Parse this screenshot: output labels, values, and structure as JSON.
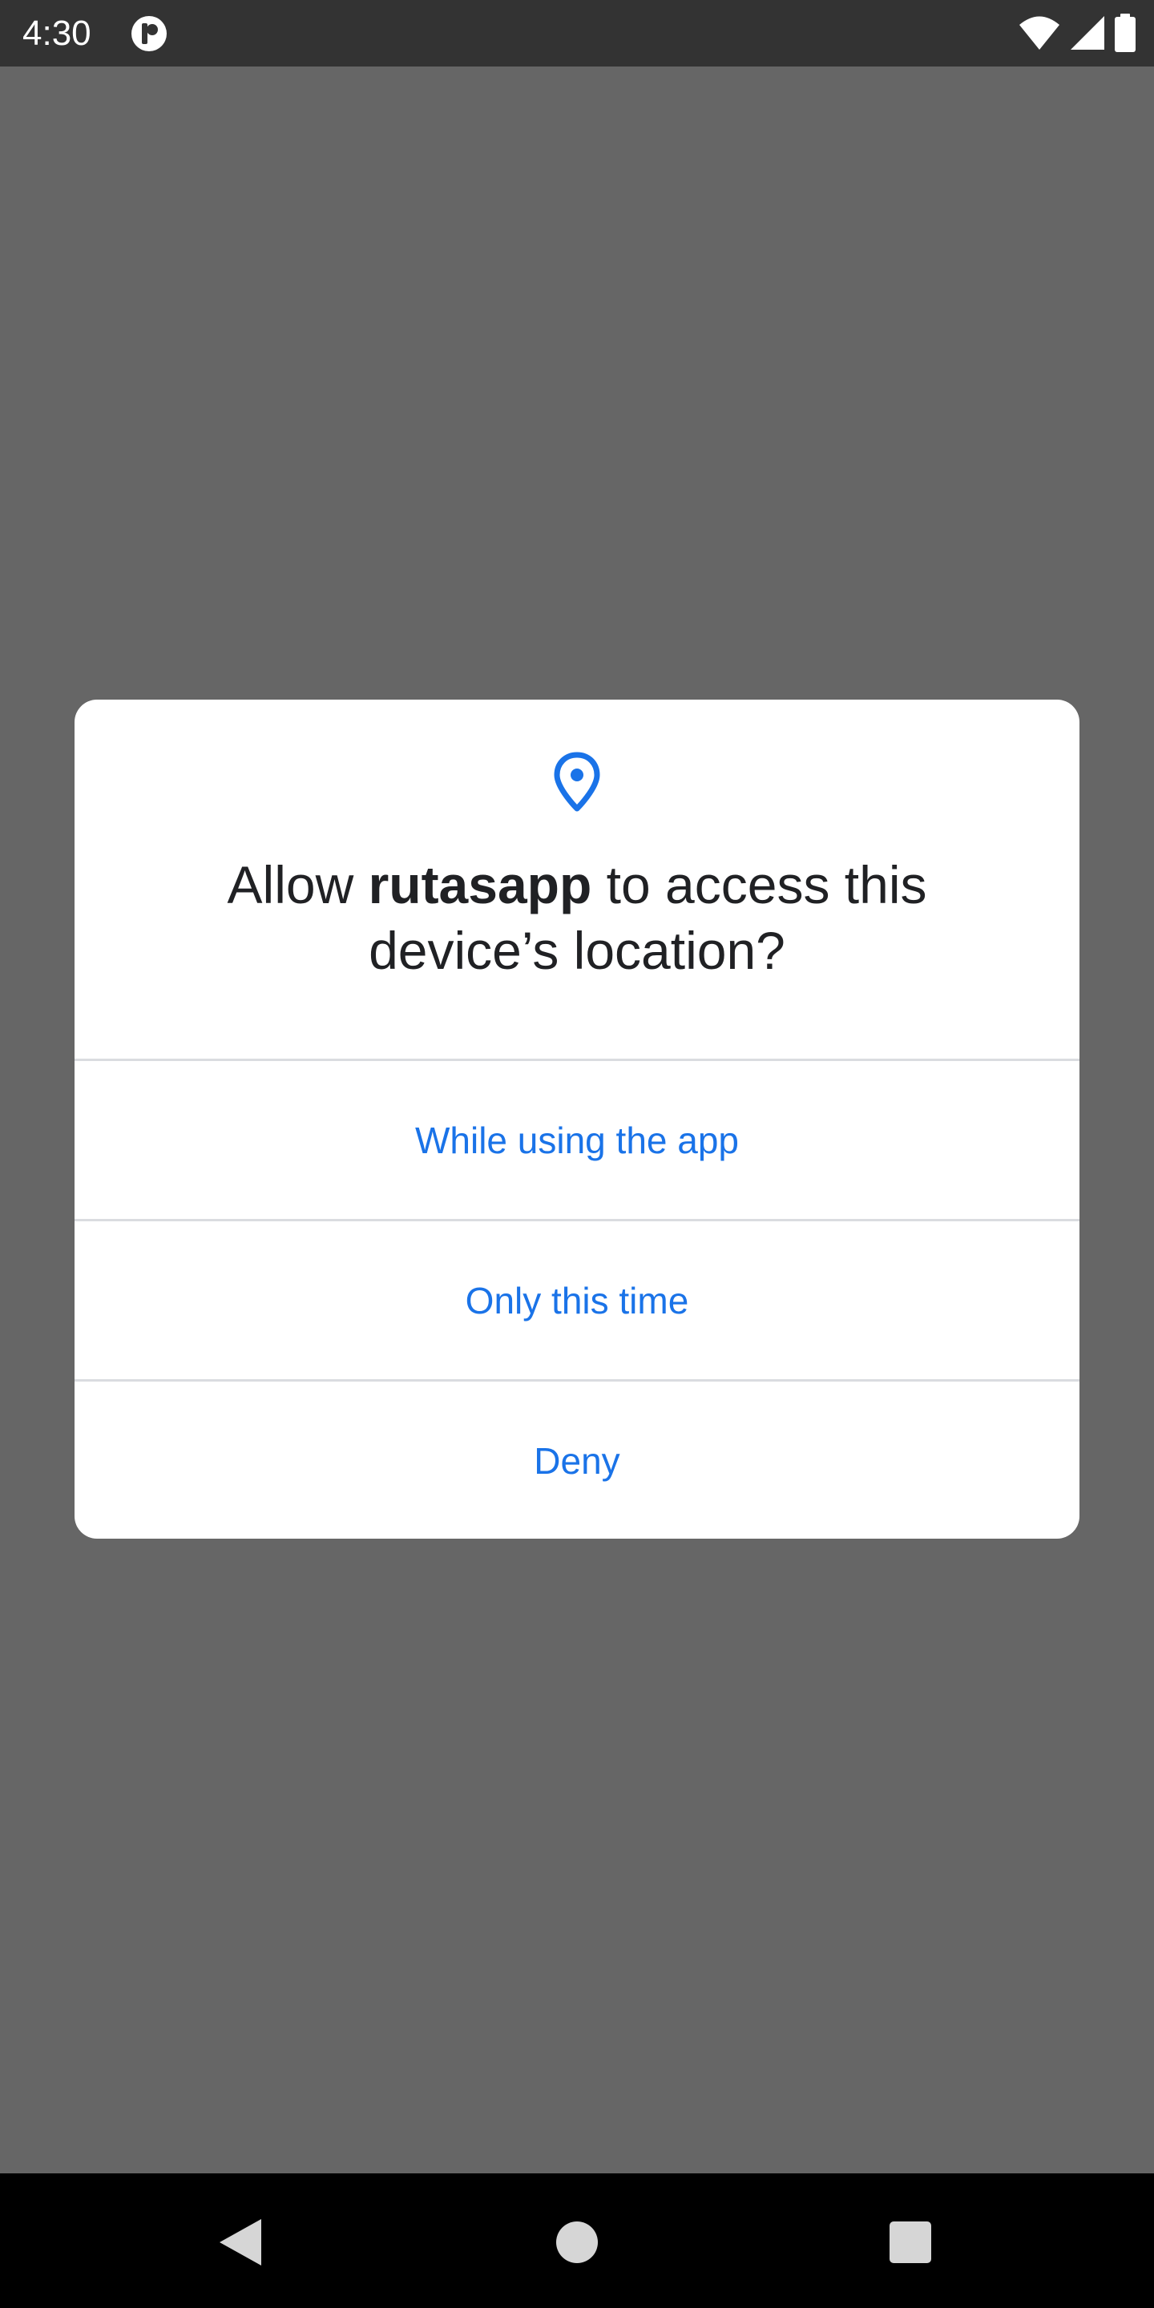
{
  "status_bar": {
    "time": "4:30",
    "app_icon": "rutasapp-status-icon",
    "icons": [
      "wifi-icon",
      "signal-icon",
      "battery-icon"
    ]
  },
  "dialog": {
    "icon": "location-pin-icon",
    "title_prefix": "Allow ",
    "app_name": "rutasapp",
    "title_suffix": " to access this device’s location?",
    "options": [
      {
        "label": "While using the app"
      },
      {
        "label": "Only this time"
      },
      {
        "label": "Deny"
      }
    ]
  },
  "nav_bar": {
    "icons": [
      "back-icon",
      "home-icon",
      "recents-icon"
    ]
  },
  "colors": {
    "scrim": "#666666",
    "status_bar": "#333333",
    "accent": "#1a73e8",
    "title_text": "#202124",
    "divider": "#dadce0"
  }
}
